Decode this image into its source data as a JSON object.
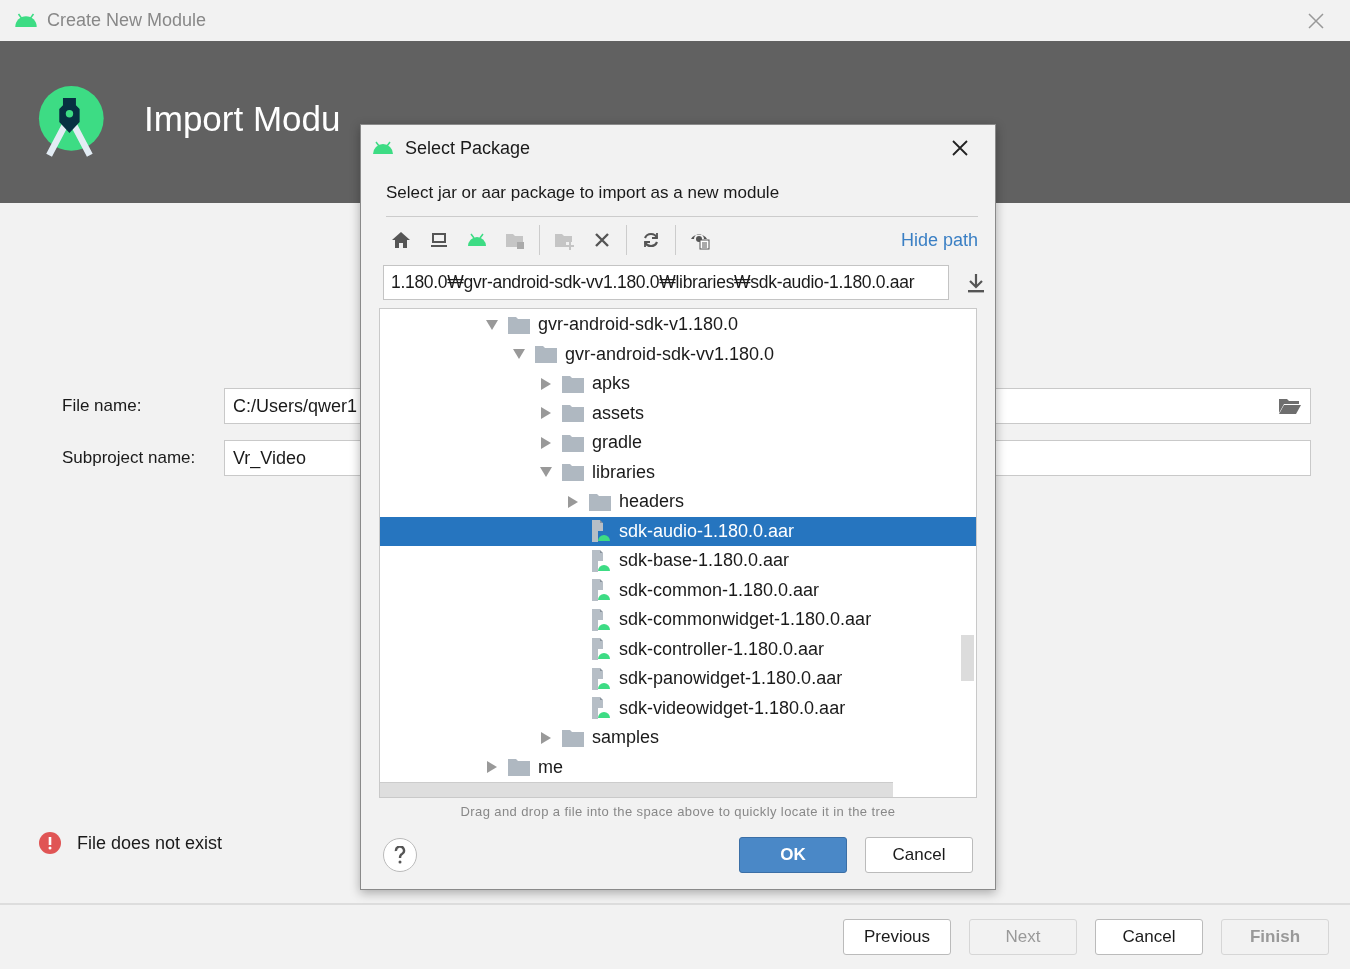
{
  "window": {
    "title": "Create New Module"
  },
  "header": {
    "title": "Import Modu"
  },
  "form": {
    "fields": [
      {
        "label": "File name:",
        "value": "C:/Users/qwer1",
        "kind": "file"
      },
      {
        "label": "Subproject name:",
        "value": "Vr_Video",
        "kind": "text"
      }
    ],
    "error": "File does not exist"
  },
  "buttons": [
    {
      "label": "Previous",
      "disabled": false,
      "default": false
    },
    {
      "label": "Next",
      "disabled": true,
      "default": false
    },
    {
      "label": "Cancel",
      "disabled": false,
      "default": false
    },
    {
      "label": "Finish",
      "disabled": true,
      "default": true
    }
  ],
  "dialog": {
    "title": "Select Package",
    "description": "Select jar or aar package to import as a new module",
    "toolbar": [
      {
        "kind": "home",
        "disabled": false
      },
      {
        "kind": "desktop",
        "disabled": false
      },
      {
        "kind": "android",
        "disabled": false
      },
      {
        "kind": "folder",
        "disabled": true
      },
      {
        "kind": "separator"
      },
      {
        "kind": "new-folder",
        "disabled": true
      },
      {
        "kind": "delete",
        "disabled": false
      },
      {
        "kind": "separator"
      },
      {
        "kind": "refresh",
        "disabled": false
      },
      {
        "kind": "separator"
      },
      {
        "kind": "hidden-files",
        "disabled": false
      }
    ],
    "hide_path": "Hide path",
    "path": "1.180.0₩gvr-android-sdk-vv1.180.0₩libraries₩sdk-audio-1.180.0.aar",
    "tree": [
      {
        "label": "gvr-android-sdk-v1.180.0",
        "kind": "folder",
        "expanded": true,
        "selected": false,
        "children": [
          {
            "label": "gvr-android-sdk-vv1.180.0",
            "kind": "folder",
            "expanded": true,
            "selected": false,
            "children": [
              {
                "label": "apks",
                "kind": "folder",
                "expanded": false,
                "selected": false
              },
              {
                "label": "assets",
                "kind": "folder",
                "expanded": false,
                "selected": false
              },
              {
                "label": "gradle",
                "kind": "folder",
                "expanded": false,
                "selected": false
              },
              {
                "label": "libraries",
                "kind": "folder",
                "expanded": true,
                "selected": false,
                "children": [
                  {
                    "label": "headers",
                    "kind": "folder",
                    "expanded": false,
                    "selected": false
                  },
                  {
                    "label": "sdk-audio-1.180.0.aar",
                    "kind": "file",
                    "selected": true
                  },
                  {
                    "label": "sdk-base-1.180.0.aar",
                    "kind": "file",
                    "selected": false
                  },
                  {
                    "label": "sdk-common-1.180.0.aar",
                    "kind": "file",
                    "selected": false
                  },
                  {
                    "label": "sdk-commonwidget-1.180.0.aar",
                    "kind": "file",
                    "selected": false
                  },
                  {
                    "label": "sdk-controller-1.180.0.aar",
                    "kind": "file",
                    "selected": false
                  },
                  {
                    "label": "sdk-panowidget-1.180.0.aar",
                    "kind": "file",
                    "selected": false
                  },
                  {
                    "label": "sdk-videowidget-1.180.0.aar",
                    "kind": "file",
                    "selected": false
                  }
                ]
              },
              {
                "label": "samples",
                "kind": "folder",
                "expanded": false,
                "selected": false
              }
            ]
          }
        ]
      },
      {
        "label": "me",
        "kind": "folder",
        "expanded": false,
        "selected": false
      }
    ],
    "hint": "Drag and drop a file into the space above to quickly locate it in the tree",
    "buttons": [
      {
        "label": "OK",
        "disabled": false,
        "default": true
      },
      {
        "label": "Cancel",
        "disabled": false,
        "default": false
      }
    ]
  }
}
